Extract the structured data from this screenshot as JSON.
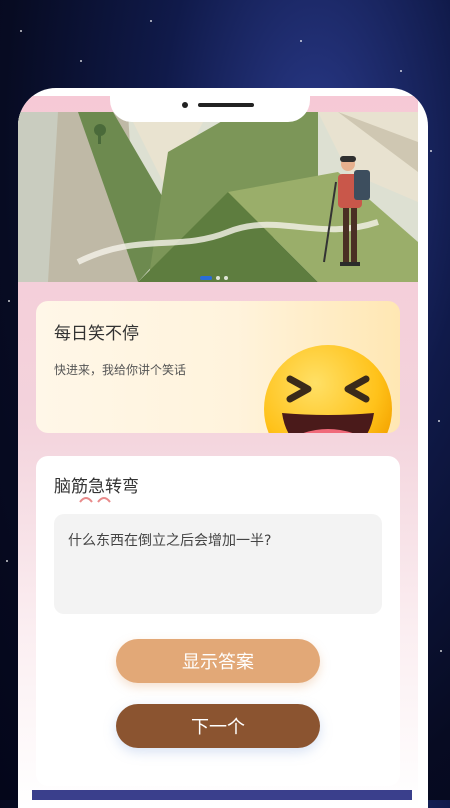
{
  "banner": {
    "alt": "hiker on mountain book landscape",
    "slides": 3,
    "active": 0
  },
  "joke_card": {
    "title": "每日笑不停",
    "subtitle": "快进来，我给你讲个笑话"
  },
  "riddle_card": {
    "title": "脑筋急转弯",
    "question": "什么东西在倒立之后会增加一半?",
    "show_answer_label": "显示答案",
    "next_label": "下一个"
  },
  "colors": {
    "answer_button": "#e2a877",
    "next_button": "#8b5430",
    "slide_active": "#2a6dd9"
  }
}
